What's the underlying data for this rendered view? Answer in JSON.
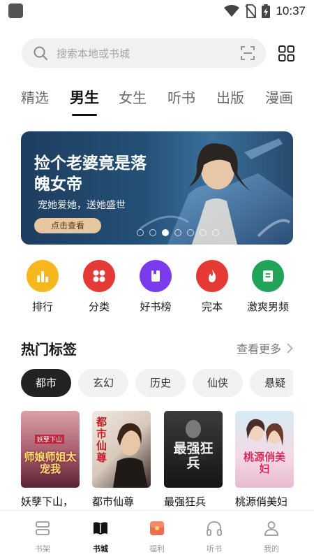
{
  "status_bar": {
    "time": "10:37"
  },
  "search": {
    "placeholder": "搜索本地或书城"
  },
  "tabs": [
    {
      "label": "精选"
    },
    {
      "label": "男生",
      "active": true
    },
    {
      "label": "女生"
    },
    {
      "label": "听书"
    },
    {
      "label": "出版"
    },
    {
      "label": "漫画"
    }
  ],
  "banner": {
    "title": "捡个老婆竟是落魄女帝",
    "subtitle": "宠她爱她，送她盛世",
    "button_label": "点击查看",
    "page_count": 7,
    "active_page": 2
  },
  "entries": [
    {
      "label": "排行",
      "icon": "bar-chart-icon",
      "color": "#f6b81e"
    },
    {
      "label": "分类",
      "icon": "category-icon",
      "color": "#e53935"
    },
    {
      "label": "好书榜",
      "icon": "bookmark-icon",
      "color": "#7c3aed"
    },
    {
      "label": "完本",
      "icon": "flame-icon",
      "color": "#e53935"
    },
    {
      "label": "激爽男频",
      "icon": "book-icon",
      "color": "#22a35a"
    }
  ],
  "hot_tags": {
    "title": "热门标签",
    "more_label": "查看更多",
    "chips": [
      "都市",
      "玄幻",
      "历史",
      "仙侠",
      "悬疑"
    ]
  },
  "books": [
    {
      "title": "妖孽下山，",
      "cover_text": "师娘师姐太宠我",
      "cover_top_text": "妖孽下山"
    },
    {
      "title": "都市仙尊",
      "cover_text": "都市仙尊"
    },
    {
      "title": "最强狂兵",
      "cover_text": "最强狂兵"
    },
    {
      "title": "桃源俏美妇",
      "cover_text": "桃源俏美妇"
    }
  ],
  "bottom_nav": [
    {
      "label": "书架",
      "icon": "bookshelf-icon"
    },
    {
      "label": "书城",
      "icon": "bookstore-icon",
      "active": true
    },
    {
      "label": "福利",
      "icon": "gift-icon"
    },
    {
      "label": "听书",
      "icon": "headphones-icon"
    },
    {
      "label": "我的",
      "icon": "profile-icon"
    }
  ],
  "colors": {
    "accent": "#111111",
    "banner_button": "#e7c7a0",
    "chip_active": "#222222",
    "chip_inactive": "#f2f2f2"
  }
}
